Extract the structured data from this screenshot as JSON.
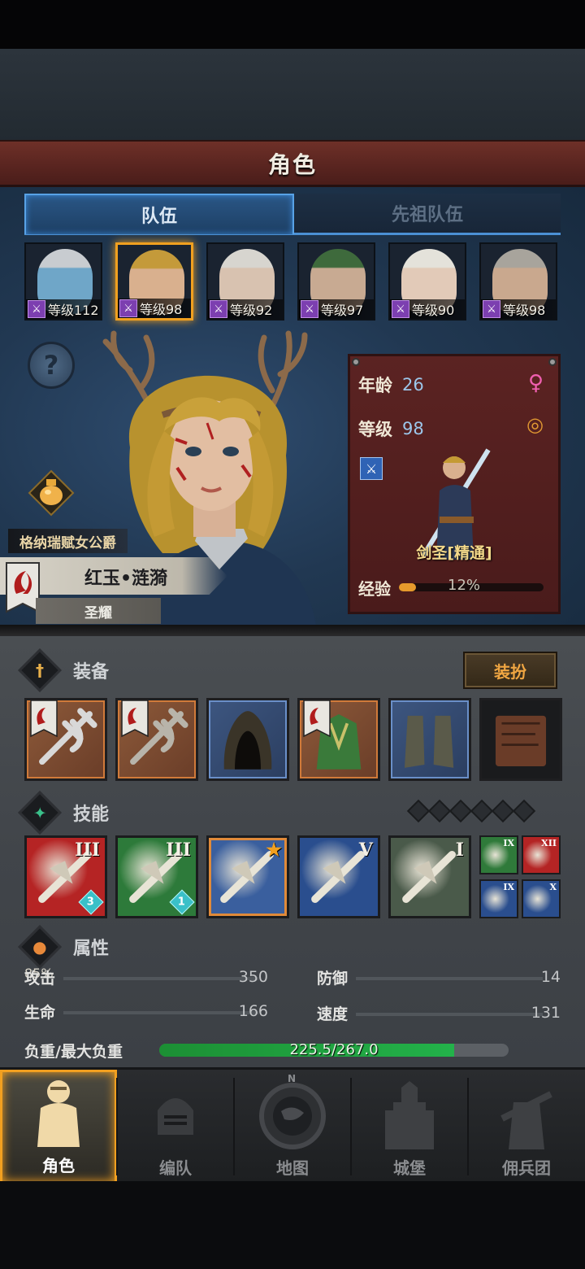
{
  "header": {
    "title": "角色"
  },
  "tabs": [
    {
      "label": "队伍",
      "active": true
    },
    {
      "label": "先祖队伍",
      "active": false
    }
  ],
  "roster": [
    {
      "level": "等级112",
      "skin": "#6fa6c8",
      "hair": "#c8ccd0",
      "selected": false
    },
    {
      "level": "等级98",
      "skin": "#d9b08e",
      "hair": "#c49a3a",
      "selected": true
    },
    {
      "level": "等级92",
      "skin": "#d8c2b0",
      "hair": "#d7d5cf",
      "selected": false
    },
    {
      "level": "等级97",
      "skin": "#c8aa92",
      "hair": "#3e6a3c",
      "selected": false
    },
    {
      "level": "等级90",
      "skin": "#e2cab8",
      "hair": "#e4e2da",
      "selected": false
    },
    {
      "level": "等级98",
      "skin": "#c9a88e",
      "hair": "#a8a49c",
      "selected": false
    }
  ],
  "hero": {
    "title": "格纳瑞赋女公爵",
    "name": "红玉•涟漪",
    "faction": "圣耀"
  },
  "stats_card": {
    "age_label": "年龄",
    "age_value": "26",
    "level_label": "等级",
    "level_value": "98",
    "class_name": "剑圣[精通]",
    "exp_label": "经验",
    "exp_percent_text": "12%",
    "exp_fraction": 0.12,
    "gender_icon": "female-icon",
    "ring_icon": "ring-icon"
  },
  "equipment": {
    "section_title": "装备",
    "dress_button": "装扮",
    "slots": [
      {
        "name": "halberd-slot",
        "rarity": "orange",
        "faction_flag": true
      },
      {
        "name": "halberd-slot-2",
        "rarity": "orange",
        "faction_flag": true
      },
      {
        "name": "hood-slot",
        "rarity": "blue",
        "faction_flag": false
      },
      {
        "name": "armor-slot",
        "rarity": "orange",
        "faction_flag": true
      },
      {
        "name": "boots-slot",
        "rarity": "blue",
        "faction_flag": false
      },
      {
        "name": "book-slot",
        "rarity": "dark",
        "faction_flag": false
      }
    ]
  },
  "skills": {
    "section_title": "技能",
    "pips": 6,
    "slots": [
      {
        "rank": "III",
        "gem": "3",
        "bg": "#b52424",
        "highlight": false
      },
      {
        "rank": "III",
        "gem": "1",
        "bg": "#2d7a3a",
        "highlight": false
      },
      {
        "rank": "",
        "gem": "",
        "bg": "#3a5f9e",
        "highlight": true
      },
      {
        "rank": "V",
        "gem": "",
        "bg": "#2a4e8e",
        "highlight": false
      },
      {
        "rank": "I",
        "gem": "",
        "bg": "#4a5a4a",
        "highlight": false
      }
    ],
    "mini": [
      {
        "rank": "IX",
        "bg": "#2f7a3a"
      },
      {
        "rank": "XII",
        "bg": "#b42424"
      },
      {
        "rank": "IX",
        "bg": "#2a4e8e"
      },
      {
        "rank": "X",
        "bg": "#2a4e8e"
      }
    ]
  },
  "attributes": {
    "section_title": "属性",
    "attack_label": "攻击",
    "attack_value": "350",
    "defense_label": "防御",
    "defense_value": "14",
    "hp_label": "生命",
    "hp_value": "166",
    "speed_label": "速度",
    "speed_value": "131",
    "load_label": "负重/最大负重",
    "load_text": "225.5/267.0",
    "load_fraction": 0.845,
    "load_percent": "85%"
  },
  "nav": [
    {
      "label": "角色",
      "icon": "knight-icon",
      "active": true
    },
    {
      "label": "编队",
      "icon": "helmet-icon",
      "active": false
    },
    {
      "label": "地图",
      "icon": "compass-map-icon",
      "active": false,
      "compass_n": "N"
    },
    {
      "label": "城堡",
      "icon": "castle-icon",
      "active": false
    },
    {
      "label": "佣兵团",
      "icon": "mercenary-icon",
      "active": false
    }
  ],
  "colors": {
    "accent": "#f2a020",
    "tab_blue": "#4b90d4",
    "title_red": "#5a2520"
  }
}
